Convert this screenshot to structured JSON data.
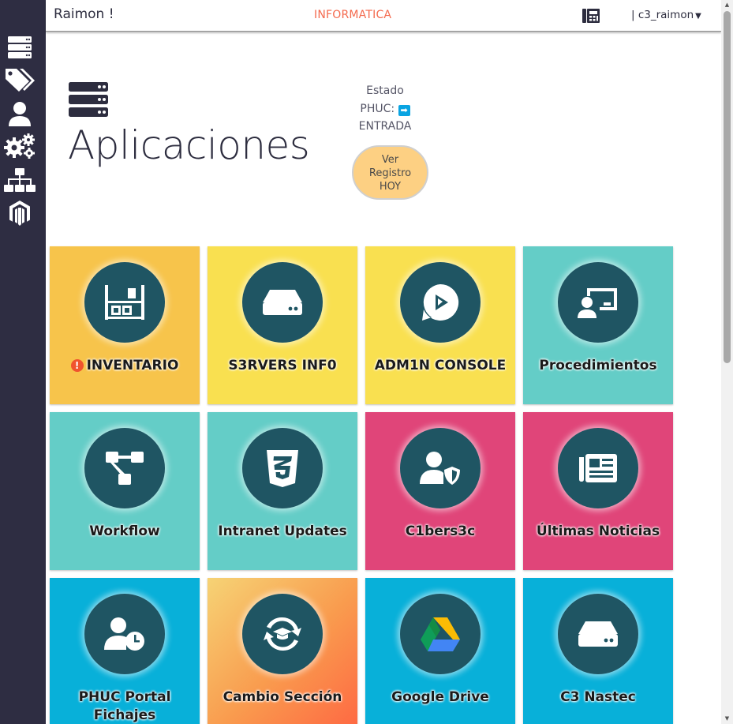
{
  "header": {
    "brand": "Raimon !",
    "department": "INFORMATICA",
    "user_menu": "| c3_raimon"
  },
  "sidebar": {
    "items": [
      {
        "icon": "server-icon"
      },
      {
        "icon": "tags-icon"
      },
      {
        "icon": "user-icon"
      },
      {
        "icon": "cogs-icon"
      },
      {
        "icon": "sitemap-icon"
      },
      {
        "icon": "magento-icon"
      }
    ]
  },
  "main": {
    "title": "Aplicaciones",
    "status": {
      "line1": "Estado",
      "line2": "PHUC:",
      "line3": "ENTRADA"
    },
    "registro_button": {
      "line1": "Ver",
      "line2": "Registro",
      "line3": "HOY"
    }
  },
  "tiles": [
    {
      "label": "INVENTARIO",
      "color": "#f7c44b",
      "icon": "warehouse-icon",
      "alert": true
    },
    {
      "label": "S3RVERS INF0",
      "color": "#f9e050",
      "icon": "hdd-icon"
    },
    {
      "label": "ADM1N CONSOLE",
      "color": "#f9e050",
      "icon": "console-icon"
    },
    {
      "label": "Procedimientos",
      "color": "#64cdc7",
      "icon": "chalkboard-user-icon"
    },
    {
      "label": "Workflow",
      "color": "#64cdc7",
      "icon": "workflow-icon"
    },
    {
      "label": "Intranet Updates",
      "color": "#64cdc7",
      "icon": "css3-icon"
    },
    {
      "label": "C1bers3c",
      "color": "#e04579",
      "icon": "user-shield-icon"
    },
    {
      "label": "Últimas Noticias",
      "color": "#e04579",
      "icon": "newspaper-icon"
    },
    {
      "label": "PHUC Portal Fichajes",
      "color": "#08b0d9",
      "icon": "user-clock-icon"
    },
    {
      "label": "Cambio Sección",
      "color": "#f7a850",
      "icon": "sync-graduation-icon"
    },
    {
      "label": "Google Drive",
      "color": "#08b0d9",
      "icon": "google-drive-icon"
    },
    {
      "label": "C3 Nastec",
      "color": "#08b0d9",
      "icon": "hdd-icon"
    }
  ]
}
